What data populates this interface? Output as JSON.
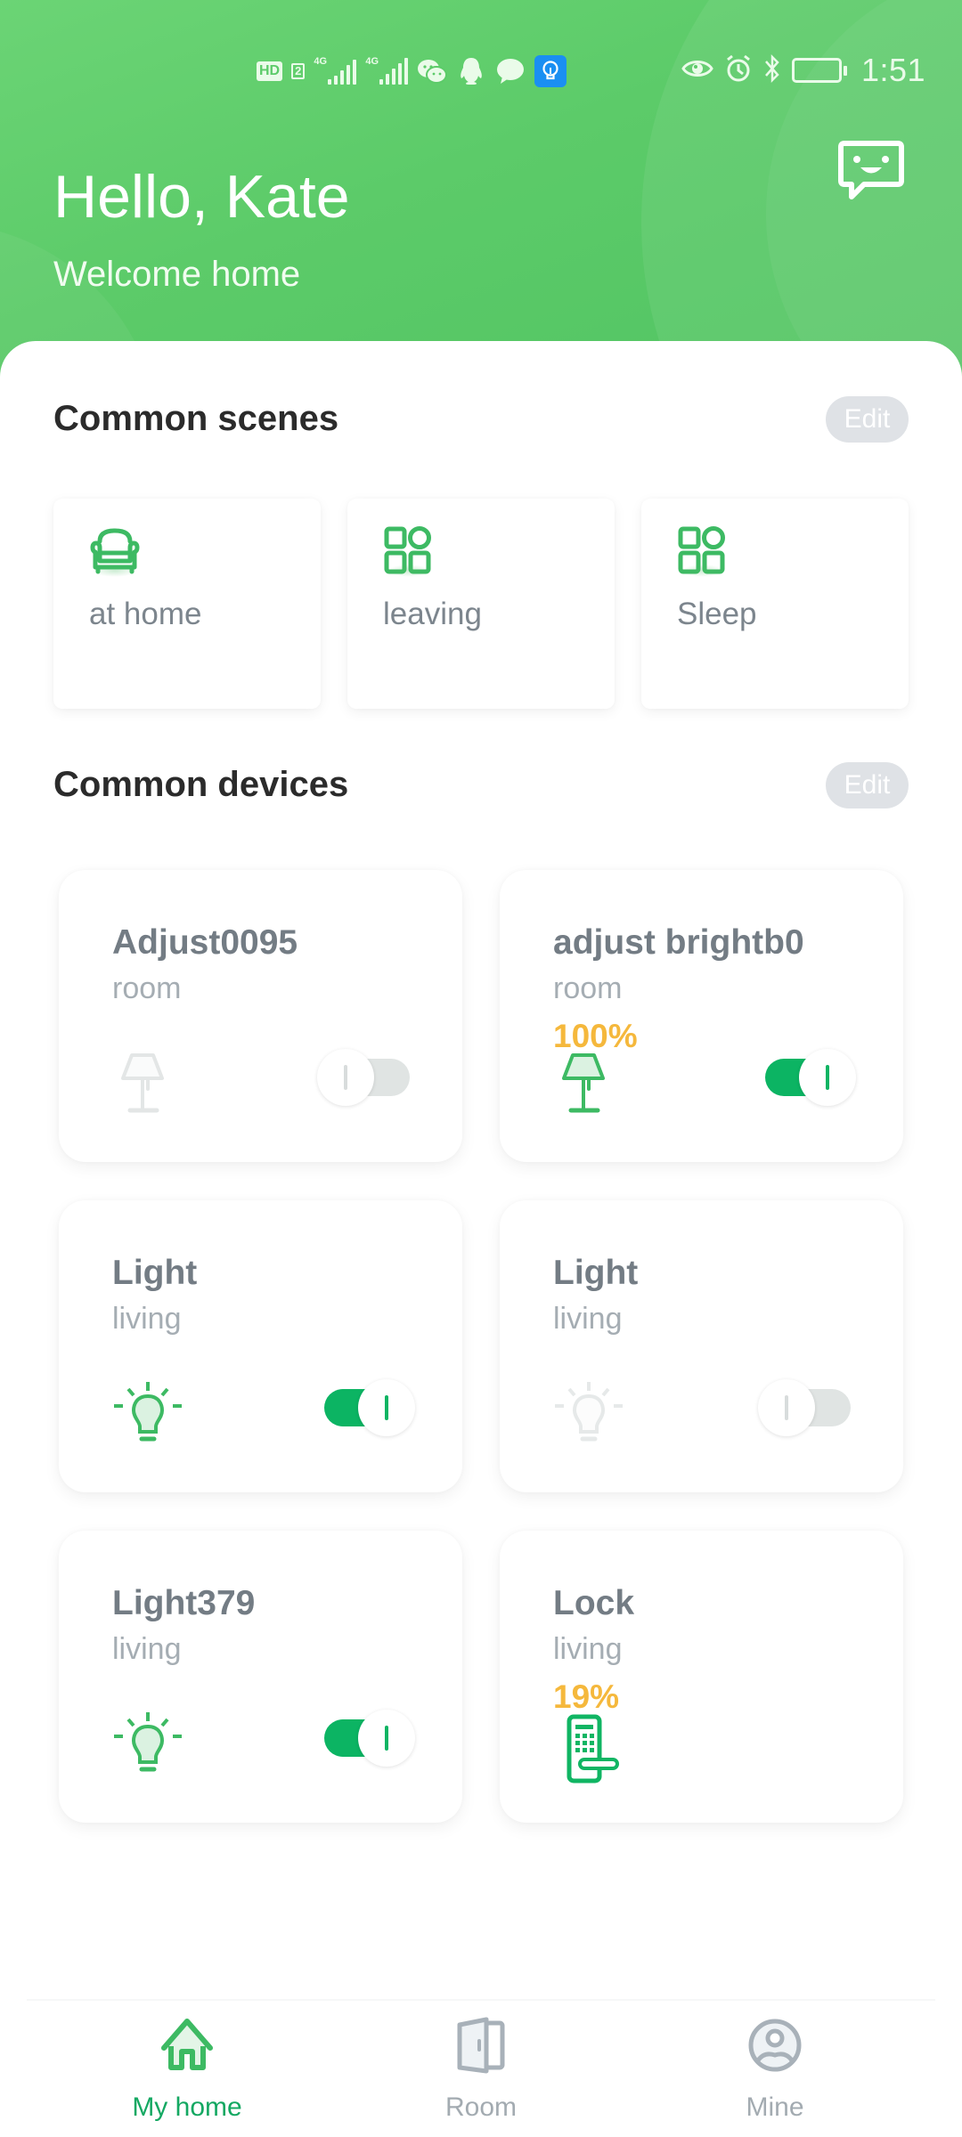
{
  "status_bar": {
    "left_icons": [
      "hd-icon",
      "sim2-icon",
      "signal-4g-sim1-icon",
      "signal-4g-sim2-icon",
      "wechat-icon",
      "qq-icon",
      "message-icon",
      "lightbulb-app-icon"
    ],
    "hd_label": "HD",
    "sim_label": "2",
    "network_label": "4G",
    "right_icons": [
      "eye-icon",
      "alarm-icon",
      "bluetooth-icon",
      "battery-icon"
    ],
    "time": "1:51"
  },
  "header": {
    "greeting": "Hello, Kate",
    "subtitle": "Welcome home",
    "chat_icon": "chat-smile-icon",
    "background_color": "#5ccb69"
  },
  "scenes": {
    "title": "Common scenes",
    "edit_label": "Edit",
    "items": [
      {
        "label": "at home",
        "icon": "armchair-icon"
      },
      {
        "label": "leaving",
        "icon": "grid-apps-icon"
      },
      {
        "label": "Sleep",
        "icon": "grid-apps-icon"
      }
    ]
  },
  "devices": {
    "title": "Common devices",
    "edit_label": "Edit",
    "items": [
      {
        "name": "Adjust0095",
        "room": "room",
        "level": null,
        "icon": "table-lamp-icon",
        "toggle": "off",
        "active": false
      },
      {
        "name": "adjust brightb0",
        "room": "room",
        "level": "100%",
        "icon": "table-lamp-icon",
        "toggle": "on",
        "active": true
      },
      {
        "name": "Light",
        "room": "living",
        "level": null,
        "icon": "light-bulb-icon",
        "toggle": "on",
        "active": true
      },
      {
        "name": "Light",
        "room": "living",
        "level": null,
        "icon": "light-bulb-icon",
        "toggle": "off",
        "active": false
      },
      {
        "name": "Light379",
        "room": "living",
        "level": null,
        "icon": "light-bulb-icon",
        "toggle": "on",
        "active": true
      },
      {
        "name": "Lock",
        "room": "living",
        "level": "19%",
        "icon": "door-lock-icon",
        "toggle": null,
        "active": true
      }
    ]
  },
  "bottom_nav": {
    "items": [
      {
        "label": "My home",
        "icon": "home-icon",
        "active": true
      },
      {
        "label": "Room",
        "icon": "door-icon",
        "active": false
      },
      {
        "label": "Mine",
        "icon": "user-profile-icon",
        "active": false
      }
    ]
  },
  "colors": {
    "accent_green": "#0cb463",
    "icon_green": "#3dba63",
    "level_yellow": "#f5b83c",
    "inactive_gray": "#a3abb1"
  }
}
